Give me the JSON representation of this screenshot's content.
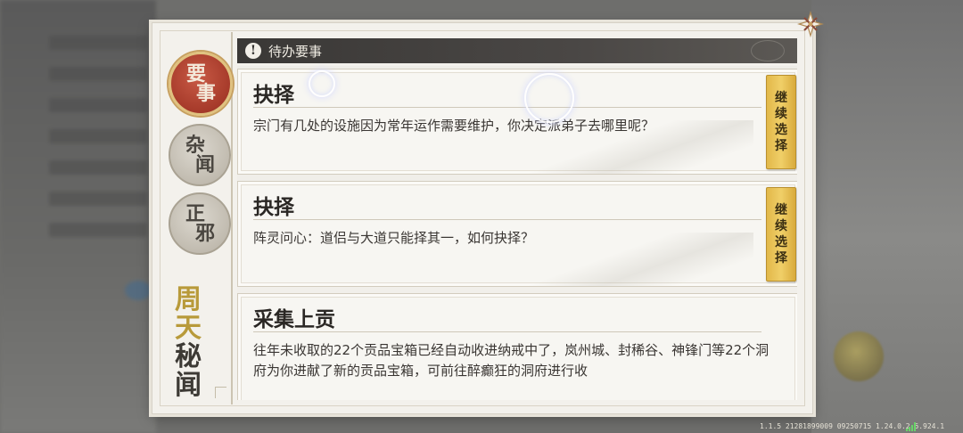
{
  "header": {
    "title": "待办要事"
  },
  "sidebar": {
    "tabs": [
      {
        "c1": "要",
        "c2": "事",
        "active": true
      },
      {
        "c1": "杂",
        "c2": "闻",
        "active": false
      },
      {
        "c1": "正",
        "c2": "邪",
        "active": false
      }
    ],
    "secret_tab": {
      "chars": [
        "周",
        "天",
        "秘",
        "闻"
      ]
    }
  },
  "tasks": [
    {
      "title": "抉择",
      "desc": "宗门有几处的设施因为常年运作需要维护，你决定派弟子去哪里呢？",
      "button": [
        "继",
        "续",
        "选",
        "择"
      ]
    },
    {
      "title": "抉择",
      "desc": "阵灵问心：道侣与大道只能择其一，如何抉择？",
      "button": [
        "继",
        "续",
        "选",
        "择"
      ]
    },
    {
      "title": "采集上贡",
      "desc": "往年未收取的22个贡品宝箱已经自动收进纳戒中了，岚州城、封稀谷、神锋门等22个洞府为你进献了新的贡品宝箱，可前往醉癫狂的洞府进行收",
      "button": null
    }
  ],
  "footer": {
    "version": "1.1.5 21281899009 09250715 1.24.0.2.6.924.1"
  },
  "colors": {
    "accent_gold": "#e9c35a",
    "active_tab": "#a63a2a",
    "header_bg": "#3a3836"
  }
}
